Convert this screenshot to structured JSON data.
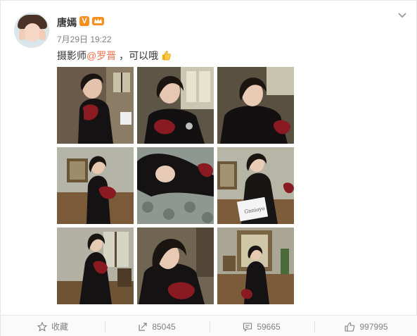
{
  "post": {
    "username": "唐嫣",
    "verified_badge": "V",
    "date": "7月29日 19:22",
    "text_prefix": "摄影师",
    "mention": "@罗晋",
    "text_suffix": " ，可以哦",
    "thumb_icon": "thumbs-up-emoji"
  },
  "photos": [
    {
      "label": "photo-1"
    },
    {
      "label": "photo-2"
    },
    {
      "label": "photo-3"
    },
    {
      "label": "photo-4"
    },
    {
      "label": "photo-5"
    },
    {
      "label": "photo-6"
    },
    {
      "label": "photo-7"
    },
    {
      "label": "photo-8"
    },
    {
      "label": "photo-9"
    }
  ],
  "photo_sign_text": "Gnnioyo",
  "actions": {
    "favorite": {
      "label": "收藏",
      "icon": "star-icon"
    },
    "repost": {
      "label": "85045",
      "icon": "share-icon"
    },
    "comment": {
      "label": "59665",
      "icon": "comment-icon"
    },
    "like": {
      "label": "997995",
      "icon": "thumbs-up-icon"
    }
  },
  "colors": {
    "mention": "#eb7350",
    "badge": "#f7901e",
    "muted": "#808080"
  }
}
